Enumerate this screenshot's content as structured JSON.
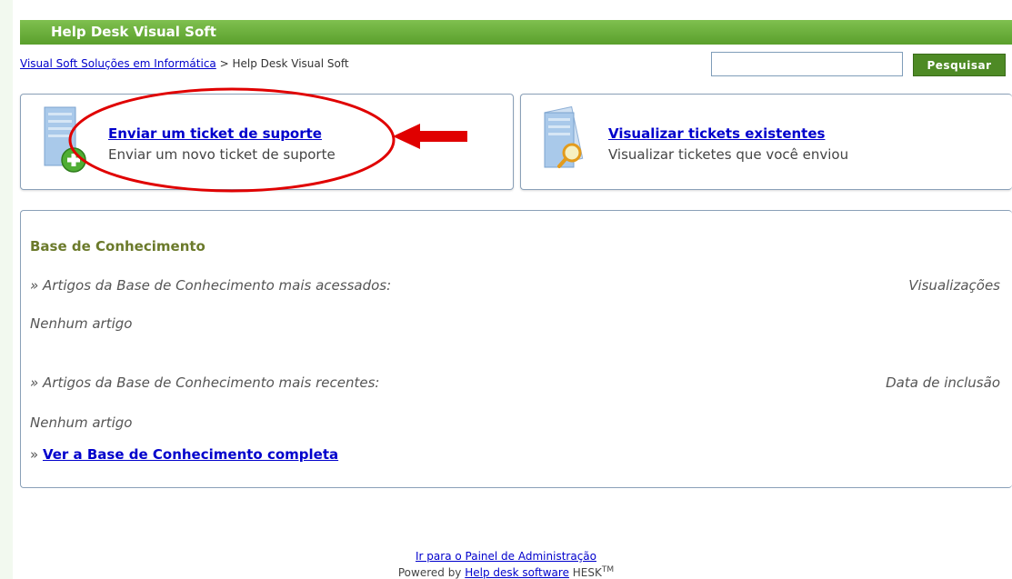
{
  "header": {
    "title": "Help Desk Visual Soft"
  },
  "breadcrumb": {
    "home_link": "Visual Soft Soluções em Informática",
    "separator": " > ",
    "current": "Help Desk Visual Soft"
  },
  "search": {
    "value": "",
    "button_label": "Pesquisar"
  },
  "cards": {
    "submit": {
      "title": "Enviar um ticket de suporte",
      "description": "Enviar um novo ticket de suporte"
    },
    "view": {
      "title": "Visualizar tickets existentes",
      "description": "Visualizar ticketes que você enviou"
    }
  },
  "knowledge_base": {
    "title": "Base de Conhecimento",
    "top_articles_label": "» Artigos da Base de Conhecimento mais acessados:",
    "top_articles_column": "Visualizações",
    "top_articles_empty": "Nenhum artigo",
    "recent_articles_label": "» Artigos da Base de Conhecimento mais recentes:",
    "recent_articles_column": "Data de inclusão",
    "recent_articles_empty": "Nenhum artigo",
    "full_link_prefix": "» ",
    "full_link": "Ver a Base de Conhecimento completa"
  },
  "footer": {
    "admin_link": "Ir para o Painel de Administração",
    "powered_prefix": "Powered by ",
    "powered_link": "Help desk software",
    "powered_brand": " HESK",
    "trademark": "TM"
  },
  "colors": {
    "header_green": "#5a9f2c",
    "button_green": "#4e8a25",
    "link_blue": "#0000cc",
    "annotation_red": "#e00000",
    "kb_title": "#6b7a2b"
  }
}
